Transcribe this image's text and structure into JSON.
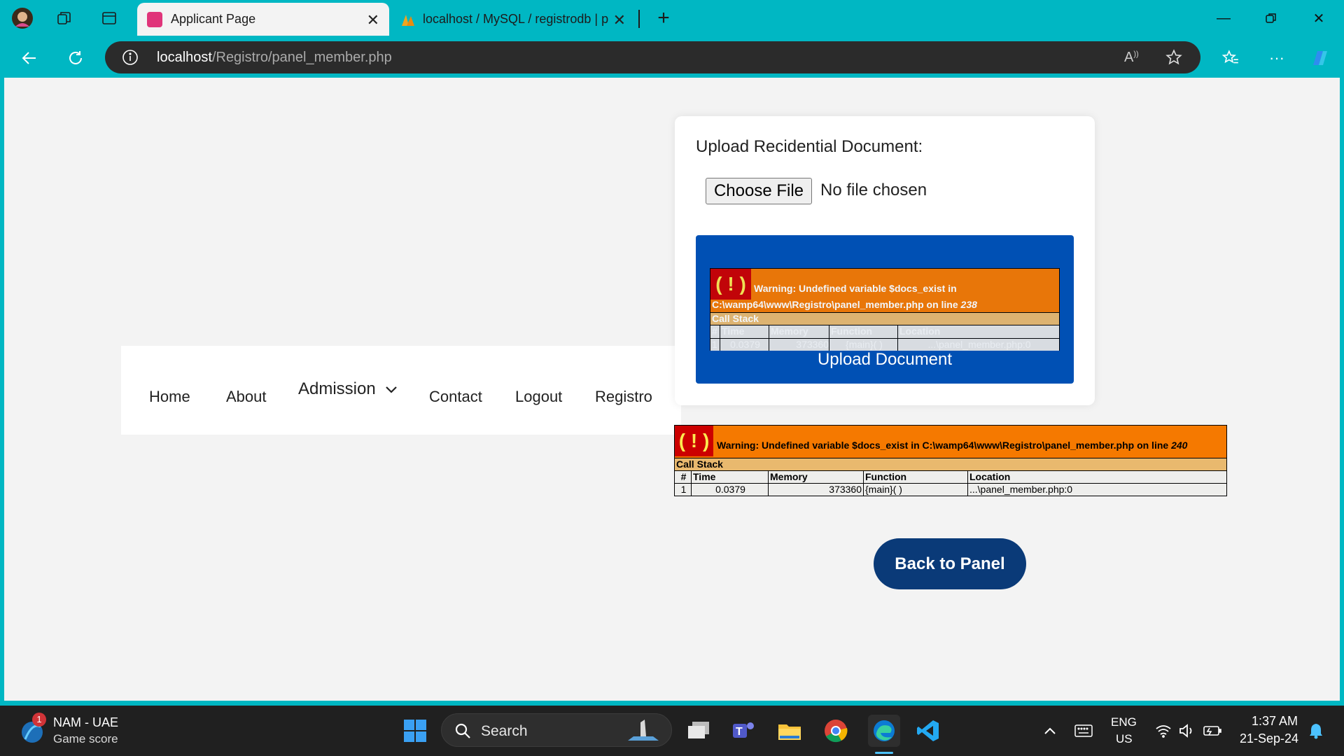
{
  "browser": {
    "tabs": [
      {
        "label": "Applicant Page",
        "active": true
      },
      {
        "label": "localhost / MySQL / registrodb | p",
        "active": false
      }
    ],
    "url": {
      "host": "localhost",
      "path": "/Registro/panel_member.php"
    }
  },
  "nav": {
    "items": [
      "Home",
      "About",
      "Admission",
      "Contact",
      "Logout",
      "Registro"
    ]
  },
  "upload": {
    "label": "Upload Recidential Document:",
    "choose_file": "Choose File",
    "file_status": "No file chosen",
    "button_label": "Upload Document"
  },
  "errors": {
    "inner": {
      "bang": "( ! )",
      "message_prefix": "Warning: Undefined variable $docs_exist in",
      "message_path": "C:\\wamp64\\www\\Registro\\panel_member.php on line",
      "line": "238",
      "call_stack": "Call Stack",
      "columns": [
        "#",
        "Time",
        "Memory",
        "Function",
        "Location"
      ],
      "row": [
        "1",
        "0.0379",
        "373360",
        "{main}( )",
        "...\\panel_member.php:0"
      ]
    },
    "outer": {
      "bang": "( ! )",
      "message": "Warning: Undefined variable $docs_exist in C:\\wamp64\\www\\Registro\\panel_member.php on line",
      "line": "240",
      "call_stack": "Call Stack",
      "columns": [
        "#",
        "Time",
        "Memory",
        "Function",
        "Location"
      ],
      "row": [
        "1",
        "0.0379",
        "373360",
        "{main}( )",
        "...\\panel_member.php:0"
      ]
    }
  },
  "back_button": "Back to Panel",
  "taskbar": {
    "widget_title": "NAM - UAE",
    "widget_subtitle": "Game score",
    "widget_badge": "1",
    "search_placeholder": "Search",
    "lang_top": "ENG",
    "lang_bottom": "US",
    "time": "1:37 AM",
    "date": "21-Sep-24"
  }
}
